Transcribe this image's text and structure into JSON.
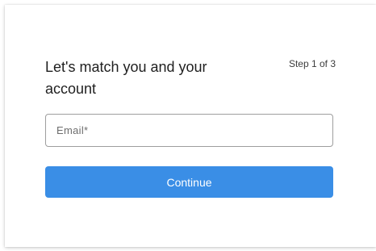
{
  "header": {
    "title": "Let's match you and your account",
    "step": "Step 1 of 3"
  },
  "form": {
    "email_placeholder": "Email*",
    "email_value": "",
    "continue_label": "Continue"
  },
  "colors": {
    "accent": "#3a8ee6",
    "border": "#9e9e9e",
    "text": "#1f1f1f"
  }
}
